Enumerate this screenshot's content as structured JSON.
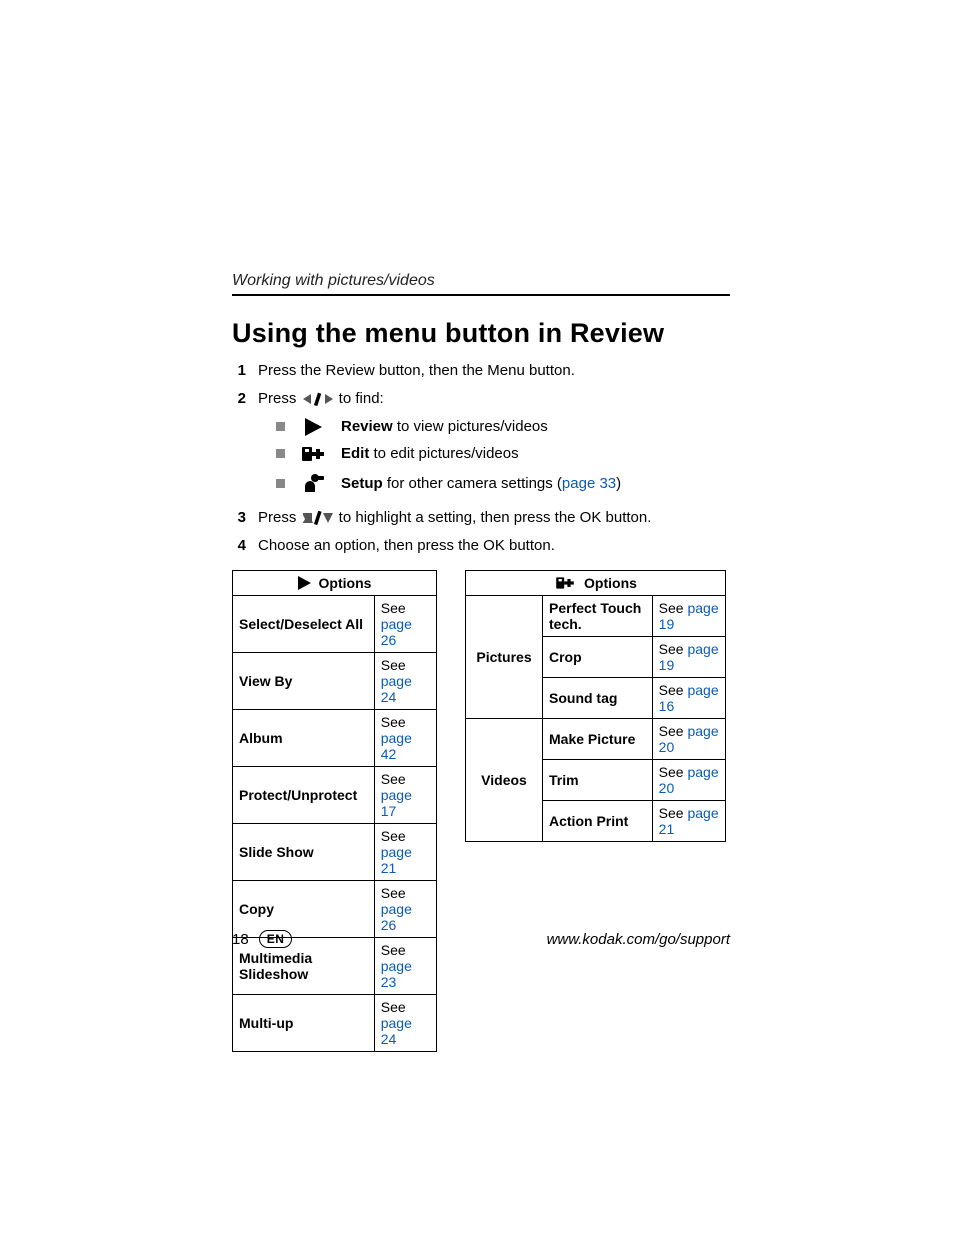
{
  "breadcrumb": "Working with pictures/videos",
  "heading": "Using the menu button in Review",
  "steps": {
    "s1": "Press the Review button, then the Menu button.",
    "s2_pre": "Press ",
    "s2_post": " to find:",
    "s3_pre": "Press ",
    "s3_post": " to highlight a setting, then press the OK button.",
    "s4": "Choose an option, then press the OK button."
  },
  "bullets": {
    "b1_bold": "Review",
    "b1_rest": " to view pictures/videos",
    "b2_bold": "Edit",
    "b2_rest": " to edit pictures/videos",
    "b3_bold": "Setup",
    "b3_rest_a": " for other camera settings (",
    "b3_link": "page 33",
    "b3_rest_b": ")"
  },
  "see": "See ",
  "options_label": "Options",
  "table1": [
    {
      "name": "Select/Deselect All",
      "link": "page 26"
    },
    {
      "name": "View By",
      "link": "page 24"
    },
    {
      "name": "Album",
      "link": "page 42"
    },
    {
      "name": "Protect/Unprotect",
      "link": "page 17"
    },
    {
      "name": "Slide Show",
      "link": "page 21"
    },
    {
      "name": "Copy",
      "link": "page 26"
    },
    {
      "name": "Multimedia Slideshow",
      "link": "page 23"
    },
    {
      "name": "Multi-up",
      "link": "page 24"
    }
  ],
  "table2": {
    "cat1": "Pictures",
    "cat2": "Videos",
    "pictures": [
      {
        "name": "Perfect Touch tech.",
        "link": "page 19"
      },
      {
        "name": "Crop",
        "link": "page 19"
      },
      {
        "name": "Sound tag",
        "link": "page 16"
      }
    ],
    "videos": [
      {
        "name": "Make Picture",
        "link": "page 20"
      },
      {
        "name": "Trim",
        "link": "page 20"
      },
      {
        "name": "Action Print",
        "link": "page 21"
      }
    ]
  },
  "footer": {
    "pagenum": "18",
    "lang": "EN",
    "url": "www.kodak.com/go/support"
  }
}
